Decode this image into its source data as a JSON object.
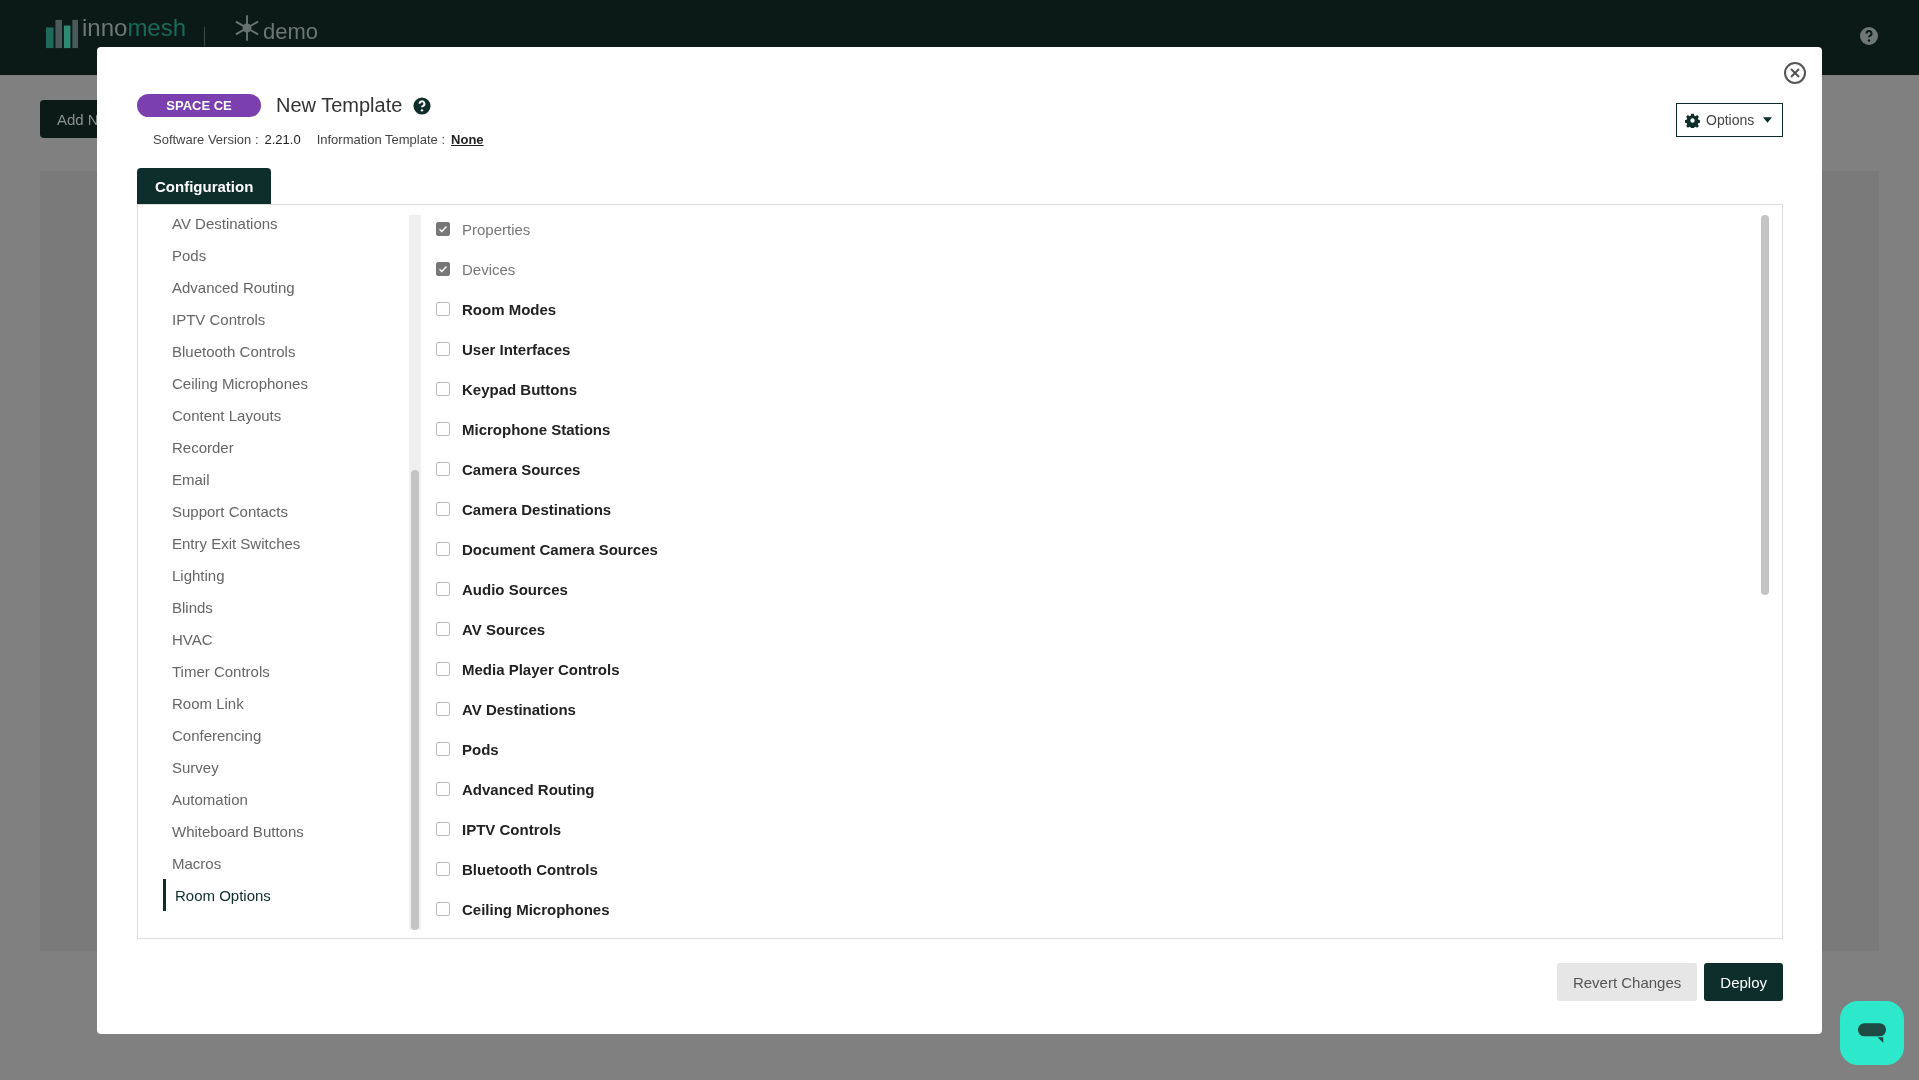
{
  "app": {
    "logo": {
      "first": "inno",
      "second": "mesh"
    },
    "workspace": "demo",
    "add_button": "Add N"
  },
  "modal": {
    "badge": "SPACE CE",
    "title": "New Template",
    "software_version_label": "Software Version :",
    "software_version": "2.21.0",
    "information_template_label": "Information Template :",
    "information_template": "None",
    "options_button": "Options",
    "tabs": [
      {
        "label": "Configuration",
        "selected": true
      }
    ],
    "nav_items": [
      {
        "label": "AV Destinations",
        "selected": false
      },
      {
        "label": "Pods",
        "selected": false
      },
      {
        "label": "Advanced Routing",
        "selected": false
      },
      {
        "label": "IPTV Controls",
        "selected": false
      },
      {
        "label": "Bluetooth Controls",
        "selected": false
      },
      {
        "label": "Ceiling Microphones",
        "selected": false
      },
      {
        "label": "Content Layouts",
        "selected": false
      },
      {
        "label": "Recorder",
        "selected": false
      },
      {
        "label": "Email",
        "selected": false
      },
      {
        "label": "Support Contacts",
        "selected": false
      },
      {
        "label": "Entry Exit Switches",
        "selected": false
      },
      {
        "label": "Lighting",
        "selected": false
      },
      {
        "label": "Blinds",
        "selected": false
      },
      {
        "label": "HVAC",
        "selected": false
      },
      {
        "label": "Timer Controls",
        "selected": false
      },
      {
        "label": "Room Link",
        "selected": false
      },
      {
        "label": "Conferencing",
        "selected": false
      },
      {
        "label": "Survey",
        "selected": false
      },
      {
        "label": "Automation",
        "selected": false
      },
      {
        "label": "Whiteboard Buttons",
        "selected": false
      },
      {
        "label": "Macros",
        "selected": false
      },
      {
        "label": "Room Options",
        "selected": true
      }
    ],
    "sections": [
      {
        "label": "Properties",
        "checked": true,
        "disabled": true
      },
      {
        "label": "Devices",
        "checked": true,
        "disabled": true
      },
      {
        "label": "Room Modes",
        "checked": false,
        "disabled": false
      },
      {
        "label": "User Interfaces",
        "checked": false,
        "disabled": false
      },
      {
        "label": "Keypad Buttons",
        "checked": false,
        "disabled": false
      },
      {
        "label": "Microphone Stations",
        "checked": false,
        "disabled": false
      },
      {
        "label": "Camera Sources",
        "checked": false,
        "disabled": false
      },
      {
        "label": "Camera Destinations",
        "checked": false,
        "disabled": false
      },
      {
        "label": "Document Camera Sources",
        "checked": false,
        "disabled": false
      },
      {
        "label": "Audio Sources",
        "checked": false,
        "disabled": false
      },
      {
        "label": "AV Sources",
        "checked": false,
        "disabled": false
      },
      {
        "label": "Media Player Controls",
        "checked": false,
        "disabled": false
      },
      {
        "label": "AV Destinations",
        "checked": false,
        "disabled": false
      },
      {
        "label": "Pods",
        "checked": false,
        "disabled": false
      },
      {
        "label": "Advanced Routing",
        "checked": false,
        "disabled": false
      },
      {
        "label": "IPTV Controls",
        "checked": false,
        "disabled": false
      },
      {
        "label": "Bluetooth Controls",
        "checked": false,
        "disabled": false
      },
      {
        "label": "Ceiling Microphones",
        "checked": false,
        "disabled": false
      }
    ],
    "buttons": {
      "revert": "Revert Changes",
      "deploy": "Deploy"
    }
  }
}
